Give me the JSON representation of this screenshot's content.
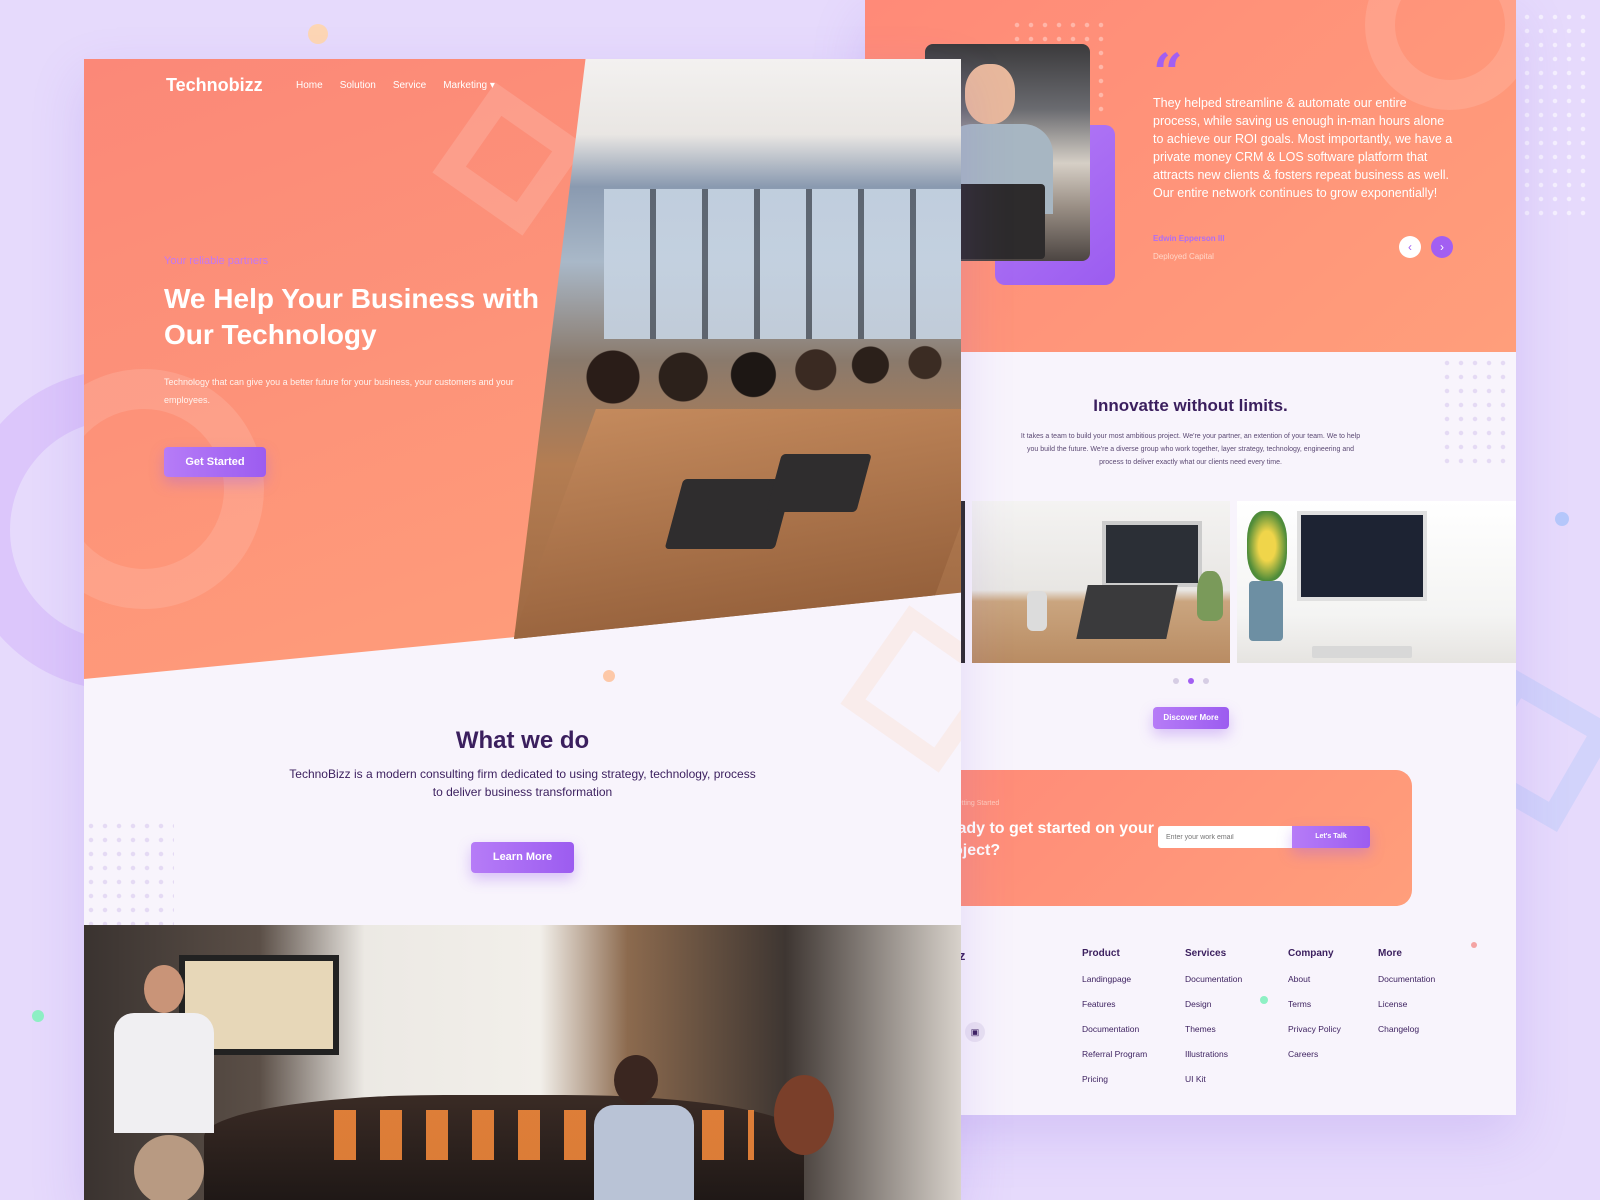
{
  "brand": {
    "name": "Technobizz",
    "footer_name": "nobizz"
  },
  "nav": {
    "items": [
      "Home",
      "Solution",
      "Service",
      "Marketing"
    ],
    "dropdown_icon": "▾"
  },
  "hero": {
    "tagline": "Your reliable partners",
    "title": "We Help Your Business with Our Technology",
    "subtitle": "Technology that can give you a better future for your business, your customers and your employees.",
    "cta": "Get Started"
  },
  "what_we_do": {
    "title": "What we do",
    "description": "TechnoBizz is a modern consulting firm dedicated to using strategy, technology, process to deliver business transformation",
    "cta": "Learn More"
  },
  "testimonial": {
    "quote_mark": "“",
    "text": "They helped streamline & automate our entire process, while saving us enough in-man hours alone to achieve our ROI goals. Most importantly, we have a private money CRM & LOS software platform that attracts new clients & fosters repeat business as well. Our entire network continues to grow exponentially!",
    "author": "Edwin Epperson III",
    "company": "Deployed Capital",
    "prev_icon": "‹",
    "next_icon": "›"
  },
  "innovate": {
    "title": "Innovatte without limits.",
    "description": "It takes a team to build your most ambitious project. We're your partner, an extention of your team. We to help you build the future. We're a diverse group who work together, layer strategy, technology, engineering and process to deliver exactly what our clients need every time.",
    "cta": "Discover More",
    "active_slide": 2,
    "slides": 3
  },
  "cta": {
    "label": "Lets Getting Started",
    "title": "Ready to get started on your project?",
    "email_placeholder": "Enter your work email",
    "button": "Let's Talk"
  },
  "footer": {
    "columns": [
      {
        "title": "Product",
        "links": [
          "Landingpage",
          "Features",
          "Documentation",
          "Referral Program",
          "Pricing"
        ]
      },
      {
        "title": "Services",
        "links": [
          "Documentation",
          "Design",
          "Themes",
          "Illustrations",
          "UI Kit"
        ]
      },
      {
        "title": "Company",
        "links": [
          "About",
          "Terms",
          "Privacy Policy",
          "Careers"
        ]
      },
      {
        "title": "More",
        "links": [
          "Documentation",
          "License",
          "Changelog"
        ]
      }
    ],
    "social_icons": [
      "twitter-icon",
      "instagram-icon",
      "linkedin-icon"
    ]
  },
  "colors": {
    "coral": "#fb8878",
    "purple": "#a25ff2",
    "navy": "#3b1f5e",
    "background": "#e6dafc"
  }
}
